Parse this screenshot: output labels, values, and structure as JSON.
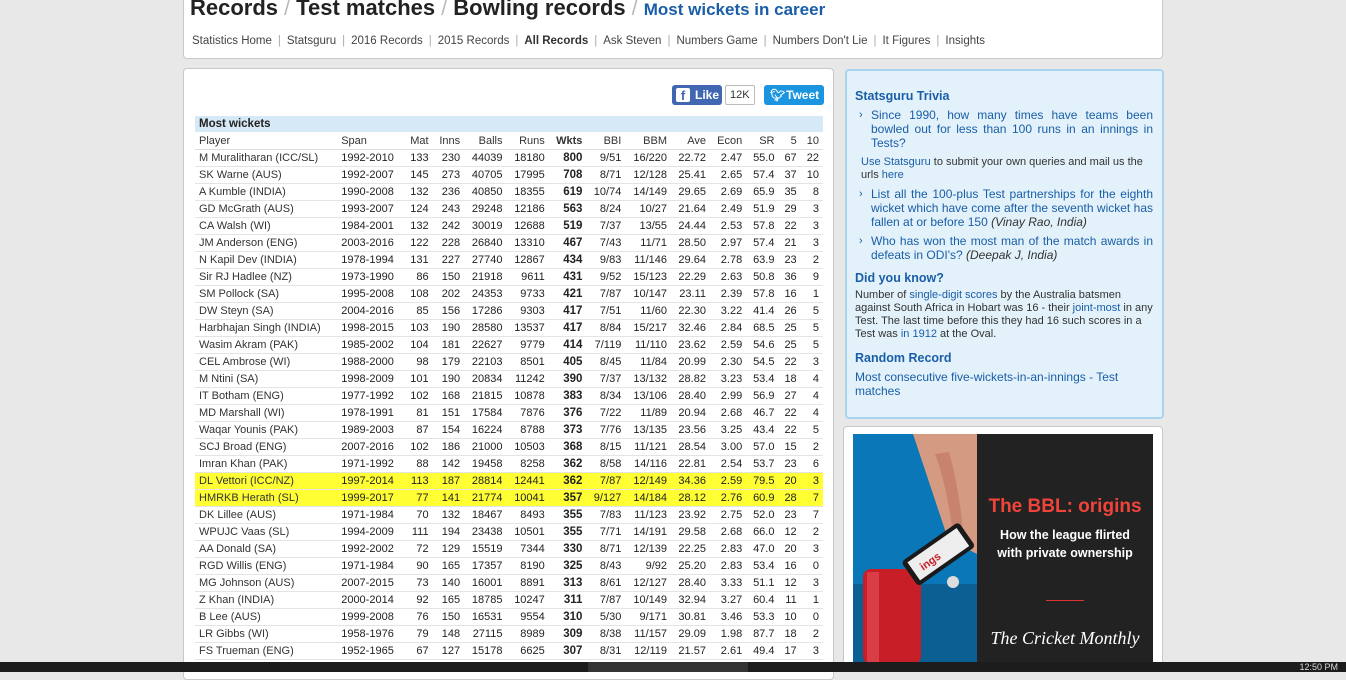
{
  "breadcrumb": {
    "items": [
      "Records",
      "Test matches",
      "Bowling records"
    ],
    "separator": "/",
    "current": "Most wickets in career"
  },
  "subnav": [
    {
      "label": "Statistics Home"
    },
    {
      "label": "Statsguru"
    },
    {
      "label": "2016 Records"
    },
    {
      "label": "2015 Records"
    },
    {
      "label": "All Records",
      "active": true
    },
    {
      "label": "Ask Steven"
    },
    {
      "label": "Numbers Game"
    },
    {
      "label": "Numbers Don't Lie"
    },
    {
      "label": "It Figures"
    },
    {
      "label": "Insights"
    }
  ],
  "social": {
    "like_label": "Like",
    "like_count": "12K",
    "tweet_label": "Tweet",
    "fb_icon": "f"
  },
  "table": {
    "caption": "Most wickets",
    "columns": [
      "Player",
      "Span",
      "Mat",
      "Inns",
      "Balls",
      "Runs",
      "Wkts",
      "BBI",
      "BBM",
      "Ave",
      "Econ",
      "SR",
      "5",
      "10"
    ],
    "rows": [
      [
        "M Muralitharan (ICC/SL)",
        "1992-2010",
        "133",
        "230",
        "44039",
        "18180",
        "800",
        "9/51",
        "16/220",
        "22.72",
        "2.47",
        "55.0",
        "67",
        "22"
      ],
      [
        "SK Warne (AUS)",
        "1992-2007",
        "145",
        "273",
        "40705",
        "17995",
        "708",
        "8/71",
        "12/128",
        "25.41",
        "2.65",
        "57.4",
        "37",
        "10"
      ],
      [
        "A Kumble (INDIA)",
        "1990-2008",
        "132",
        "236",
        "40850",
        "18355",
        "619",
        "10/74",
        "14/149",
        "29.65",
        "2.69",
        "65.9",
        "35",
        "8"
      ],
      [
        "GD McGrath (AUS)",
        "1993-2007",
        "124",
        "243",
        "29248",
        "12186",
        "563",
        "8/24",
        "10/27",
        "21.64",
        "2.49",
        "51.9",
        "29",
        "3"
      ],
      [
        "CA Walsh (WI)",
        "1984-2001",
        "132",
        "242",
        "30019",
        "12688",
        "519",
        "7/37",
        "13/55",
        "24.44",
        "2.53",
        "57.8",
        "22",
        "3"
      ],
      [
        "JM Anderson (ENG)",
        "2003-2016",
        "122",
        "228",
        "26840",
        "13310",
        "467",
        "7/43",
        "11/71",
        "28.50",
        "2.97",
        "57.4",
        "21",
        "3"
      ],
      [
        "N Kapil Dev (INDIA)",
        "1978-1994",
        "131",
        "227",
        "27740",
        "12867",
        "434",
        "9/83",
        "11/146",
        "29.64",
        "2.78",
        "63.9",
        "23",
        "2"
      ],
      [
        "Sir RJ Hadlee (NZ)",
        "1973-1990",
        "86",
        "150",
        "21918",
        "9611",
        "431",
        "9/52",
        "15/123",
        "22.29",
        "2.63",
        "50.8",
        "36",
        "9"
      ],
      [
        "SM Pollock (SA)",
        "1995-2008",
        "108",
        "202",
        "24353",
        "9733",
        "421",
        "7/87",
        "10/147",
        "23.11",
        "2.39",
        "57.8",
        "16",
        "1"
      ],
      [
        "DW Steyn (SA)",
        "2004-2016",
        "85",
        "156",
        "17286",
        "9303",
        "417",
        "7/51",
        "11/60",
        "22.30",
        "3.22",
        "41.4",
        "26",
        "5"
      ],
      [
        "Harbhajan Singh (INDIA)",
        "1998-2015",
        "103",
        "190",
        "28580",
        "13537",
        "417",
        "8/84",
        "15/217",
        "32.46",
        "2.84",
        "68.5",
        "25",
        "5"
      ],
      [
        "Wasim Akram (PAK)",
        "1985-2002",
        "104",
        "181",
        "22627",
        "9779",
        "414",
        "7/119",
        "11/110",
        "23.62",
        "2.59",
        "54.6",
        "25",
        "5"
      ],
      [
        "CEL Ambrose (WI)",
        "1988-2000",
        "98",
        "179",
        "22103",
        "8501",
        "405",
        "8/45",
        "11/84",
        "20.99",
        "2.30",
        "54.5",
        "22",
        "3"
      ],
      [
        "M Ntini (SA)",
        "1998-2009",
        "101",
        "190",
        "20834",
        "11242",
        "390",
        "7/37",
        "13/132",
        "28.82",
        "3.23",
        "53.4",
        "18",
        "4"
      ],
      [
        "IT Botham (ENG)",
        "1977-1992",
        "102",
        "168",
        "21815",
        "10878",
        "383",
        "8/34",
        "13/106",
        "28.40",
        "2.99",
        "56.9",
        "27",
        "4"
      ],
      [
        "MD Marshall (WI)",
        "1978-1991",
        "81",
        "151",
        "17584",
        "7876",
        "376",
        "7/22",
        "11/89",
        "20.94",
        "2.68",
        "46.7",
        "22",
        "4"
      ],
      [
        "Waqar Younis (PAK)",
        "1989-2003",
        "87",
        "154",
        "16224",
        "8788",
        "373",
        "7/76",
        "13/135",
        "23.56",
        "3.25",
        "43.4",
        "22",
        "5"
      ],
      [
        "SCJ Broad (ENG)",
        "2007-2016",
        "102",
        "186",
        "21000",
        "10503",
        "368",
        "8/15",
        "11/121",
        "28.54",
        "3.00",
        "57.0",
        "15",
        "2"
      ],
      [
        "Imran Khan (PAK)",
        "1971-1992",
        "88",
        "142",
        "19458",
        "8258",
        "362",
        "8/58",
        "14/116",
        "22.81",
        "2.54",
        "53.7",
        "23",
        "6"
      ],
      [
        "DL Vettori (ICC/NZ)",
        "1997-2014",
        "113",
        "187",
        "28814",
        "12441",
        "362",
        "7/87",
        "12/149",
        "34.36",
        "2.59",
        "79.5",
        "20",
        "3"
      ],
      [
        "HMRKB Herath (SL)",
        "1999-2017",
        "77",
        "141",
        "21774",
        "10041",
        "357",
        "9/127",
        "14/184",
        "28.12",
        "2.76",
        "60.9",
        "28",
        "7"
      ],
      [
        "DK Lillee (AUS)",
        "1971-1984",
        "70",
        "132",
        "18467",
        "8493",
        "355",
        "7/83",
        "11/123",
        "23.92",
        "2.75",
        "52.0",
        "23",
        "7"
      ],
      [
        "WPUJC Vaas (SL)",
        "1994-2009",
        "111",
        "194",
        "23438",
        "10501",
        "355",
        "7/71",
        "14/191",
        "29.58",
        "2.68",
        "66.0",
        "12",
        "2"
      ],
      [
        "AA Donald (SA)",
        "1992-2002",
        "72",
        "129",
        "15519",
        "7344",
        "330",
        "8/71",
        "12/139",
        "22.25",
        "2.83",
        "47.0",
        "20",
        "3"
      ],
      [
        "RGD Willis (ENG)",
        "1971-1984",
        "90",
        "165",
        "17357",
        "8190",
        "325",
        "8/43",
        "9/92",
        "25.20",
        "2.83",
        "53.4",
        "16",
        "0"
      ],
      [
        "MG Johnson (AUS)",
        "2007-2015",
        "73",
        "140",
        "16001",
        "8891",
        "313",
        "8/61",
        "12/127",
        "28.40",
        "3.33",
        "51.1",
        "12",
        "3"
      ],
      [
        "Z Khan (INDIA)",
        "2000-2014",
        "92",
        "165",
        "18785",
        "10247",
        "311",
        "7/87",
        "10/149",
        "32.94",
        "3.27",
        "60.4",
        "11",
        "1"
      ],
      [
        "B Lee (AUS)",
        "1999-2008",
        "76",
        "150",
        "16531",
        "9554",
        "310",
        "5/30",
        "9/171",
        "30.81",
        "3.46",
        "53.3",
        "10",
        "0"
      ],
      [
        "LR Gibbs (WI)",
        "1958-1976",
        "79",
        "148",
        "27115",
        "8989",
        "309",
        "8/38",
        "11/157",
        "29.09",
        "1.98",
        "87.7",
        "18",
        "2"
      ],
      [
        "FS Trueman (ENG)",
        "1952-1965",
        "67",
        "127",
        "15178",
        "6625",
        "307",
        "8/31",
        "12/119",
        "21.57",
        "2.61",
        "49.4",
        "17",
        "3"
      ]
    ],
    "highlighted_rows": [
      19,
      20
    ],
    "highlight_color": "#ffff33"
  },
  "trivia": {
    "heading": "Statsguru Trivia",
    "item1": "Since 1990, how many times have teams been bowled out for less than 100 runs in an innings in Tests?",
    "note_link": "Use Statsguru",
    "note_text": " to submit your own queries and mail us the urls ",
    "note_here": "here",
    "item2_text": "List all the 100-plus Test partnerships for the eighth wicket which have come after the seventh wicket has fallen at or before 150 ",
    "item2_author": "(Vinay Rao, India)",
    "item3_text": "Who has won the most man of the match awards in defeats in ODI's? ",
    "item3_author": "(Deepak J, India)",
    "dyk_heading": "Did you know?",
    "dyk_p1": "Number of ",
    "dyk_link1": "single-digit scores",
    "dyk_p2": " by the Australia batsmen against South Africa in Hobart was 16 - their ",
    "dyk_link2": "joint-most",
    "dyk_p3": " in any Test. The last time before this they had 16 such scores in a Test was ",
    "dyk_link3": "in 1912",
    "dyk_p4": " at the Oval.",
    "random_heading": "Random Record",
    "random_link": "Most consecutive five-wickets-in-an-innings - Test matches"
  },
  "ad": {
    "title": "The BBL: origins",
    "subtitle_line1": "How the league flirted",
    "subtitle_line2": "with private ownership",
    "brand": "The Cricket Monthly",
    "can_label": "ings"
  },
  "taskbar": {
    "clock": "12:50 PM"
  }
}
